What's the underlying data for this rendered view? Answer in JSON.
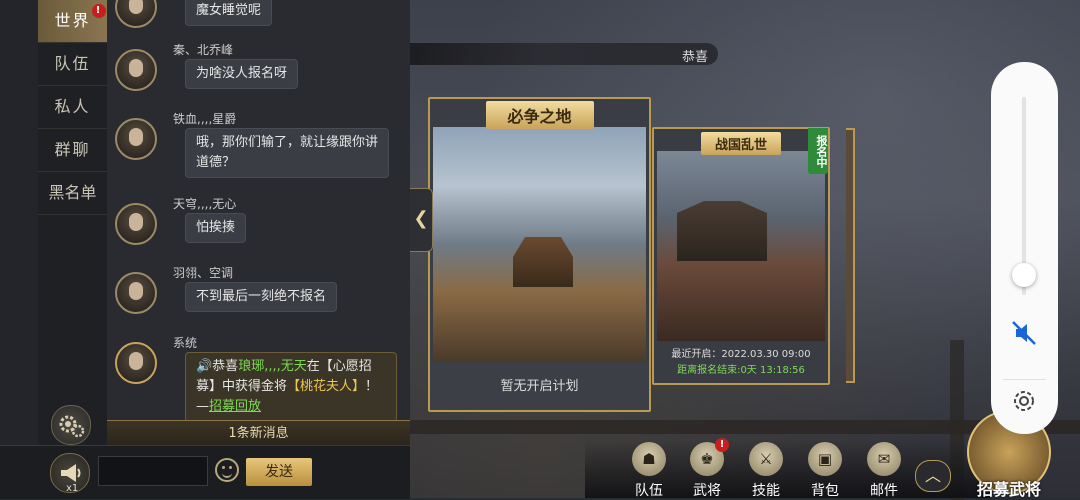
{
  "chat": {
    "tabs": [
      {
        "label": "世界",
        "active": true,
        "badge": "!"
      },
      {
        "label": "队伍"
      },
      {
        "label": "私人"
      },
      {
        "label": "群聊"
      },
      {
        "label": "黑名单"
      }
    ],
    "messages": [
      {
        "user": "",
        "text": "魔女睡觉呢"
      },
      {
        "user": "秦、北乔峰",
        "text": "为啥没人报名呀"
      },
      {
        "user": "铁血,,,,星爵",
        "text_line1": "哦，那你们输了，就让缘跟你讲",
        "text_line2": "道德？"
      },
      {
        "user": "天穹,,,,无心",
        "text": "怕挨揍"
      },
      {
        "user": "羽翎、空调",
        "text": "不到最后一刻绝不报名"
      },
      {
        "user": "系统",
        "sys_prefix": "🔊恭喜",
        "sys_name": "琅琊,,,,无天",
        "sys_mid": "在【心愿招募】中获得金将",
        "sys_item": "【桃花夫人】",
        "sys_end": "！",
        "sys_dash": "—",
        "sys_link": "招募回放"
      }
    ],
    "new_messages": "1条新消息",
    "horn_count": "x1",
    "input_value": "",
    "send_label": "发送"
  },
  "announcement": {
    "text": "恭喜"
  },
  "cards": [
    {
      "title": "必争之地",
      "status": "暂无开启计划"
    },
    {
      "title": "战国乱世",
      "tag": "报名中",
      "open_time": "最近开启：2022.03.30 09:00",
      "deadline": "距离报名结束:0天 13:18:56"
    }
  ],
  "bottom_menu": [
    {
      "label": "队伍",
      "icon": "team-icon"
    },
    {
      "label": "武将",
      "icon": "general-icon",
      "badge": "!"
    },
    {
      "label": "技能",
      "icon": "skill-icon"
    },
    {
      "label": "背包",
      "icon": "bag-icon"
    },
    {
      "label": "邮件",
      "icon": "mail-icon"
    }
  ],
  "recruit": {
    "label": "招募武将"
  },
  "volume": {
    "level": 0.1,
    "muted": true
  },
  "colors": {
    "gold": "#b99a55",
    "highlight_green": "#7ed957",
    "highlight_gold": "#f0c850",
    "badge_red": "#c81e1e"
  }
}
